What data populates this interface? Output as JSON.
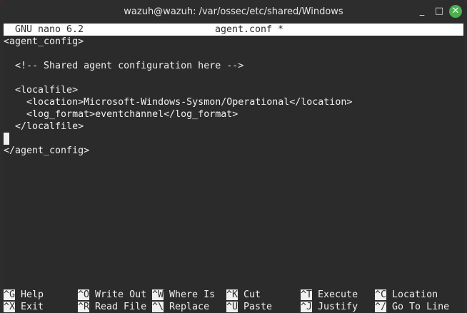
{
  "window": {
    "title": "wazuh@wazuh: /var/ossec/etc/shared/Windows",
    "minimize": "_",
    "maximize": "□",
    "close": "✕"
  },
  "nano": {
    "version": "GNU nano 6.2",
    "filename": "agent.conf *"
  },
  "lines": [
    "<agent_config>",
    "",
    "  <!-- Shared agent configuration here -->",
    "",
    "  <localfile>",
    "    <location>Microsoft-Windows-Sysmon/Operational</location>",
    "    <log_format>eventchannel</log_format>",
    "  </localfile>",
    "",
    "</agent_config>"
  ],
  "shortcuts": [
    [
      {
        "key": "^G",
        "label": "Help"
      },
      {
        "key": "^O",
        "label": "Write Out"
      },
      {
        "key": "^W",
        "label": "Where Is"
      },
      {
        "key": "^K",
        "label": "Cut"
      },
      {
        "key": "^T",
        "label": "Execute"
      },
      {
        "key": "^C",
        "label": "Location"
      }
    ],
    [
      {
        "key": "^X",
        "label": "Exit"
      },
      {
        "key": "^R",
        "label": "Read File"
      },
      {
        "key": "^\\",
        "label": "Replace"
      },
      {
        "key": "^U",
        "label": "Paste"
      },
      {
        "key": "^J",
        "label": "Justify"
      },
      {
        "key": "^/",
        "label": "Go To Line"
      }
    ]
  ],
  "colors": {
    "close_button": "#4caf50",
    "terminal_bg": "#2b2b2b"
  }
}
